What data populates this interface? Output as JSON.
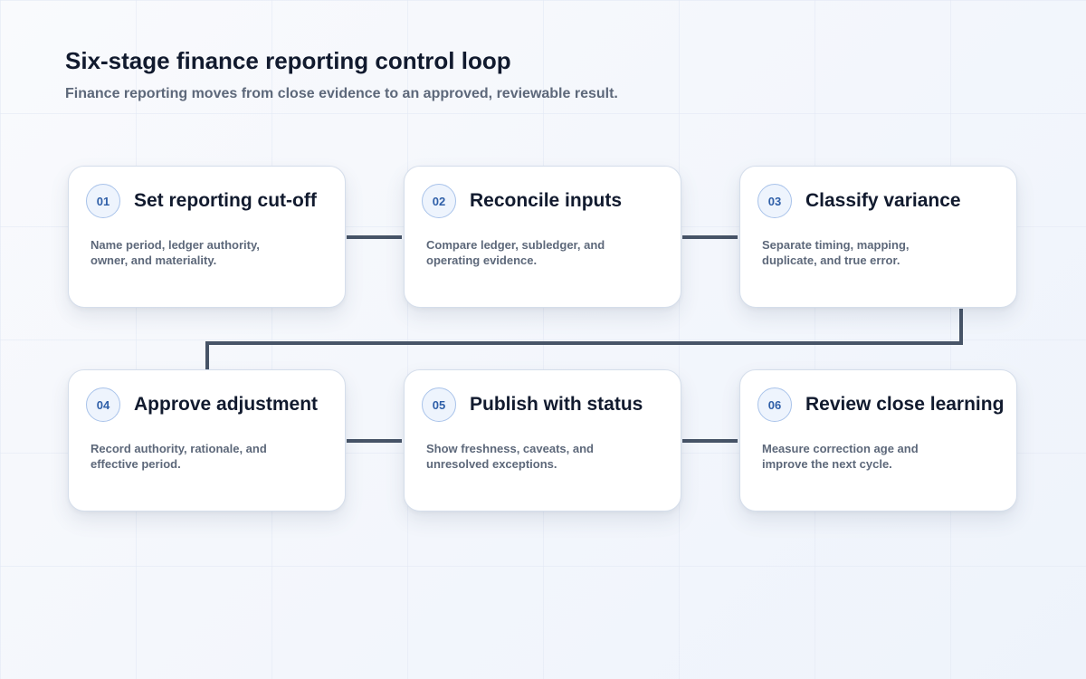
{
  "header": {
    "title": "Six-stage finance reporting control loop",
    "subtitle": "Finance reporting moves from close evidence to an approved, reviewable result."
  },
  "colors": {
    "connector": "#475467",
    "badge_text": "#2f5fa8",
    "badge_border": "#a9c3ea",
    "card_border": "#d5deeb"
  },
  "steps": [
    {
      "number": "01",
      "title": "Set reporting cut-off",
      "description": "Name period, ledger authority, owner, and materiality."
    },
    {
      "number": "02",
      "title": "Reconcile inputs",
      "description": "Compare ledger, subledger, and operating evidence."
    },
    {
      "number": "03",
      "title": "Classify variance",
      "description": "Separate timing, mapping, duplicate, and true error."
    },
    {
      "number": "04",
      "title": "Approve adjustment",
      "description": "Record authority, rationale, and effective period."
    },
    {
      "number": "05",
      "title": "Publish with status",
      "description": "Show freshness, caveats, and unresolved exceptions."
    },
    {
      "number": "06",
      "title": "Review close learning",
      "description": "Measure correction age and improve the next cycle."
    }
  ]
}
